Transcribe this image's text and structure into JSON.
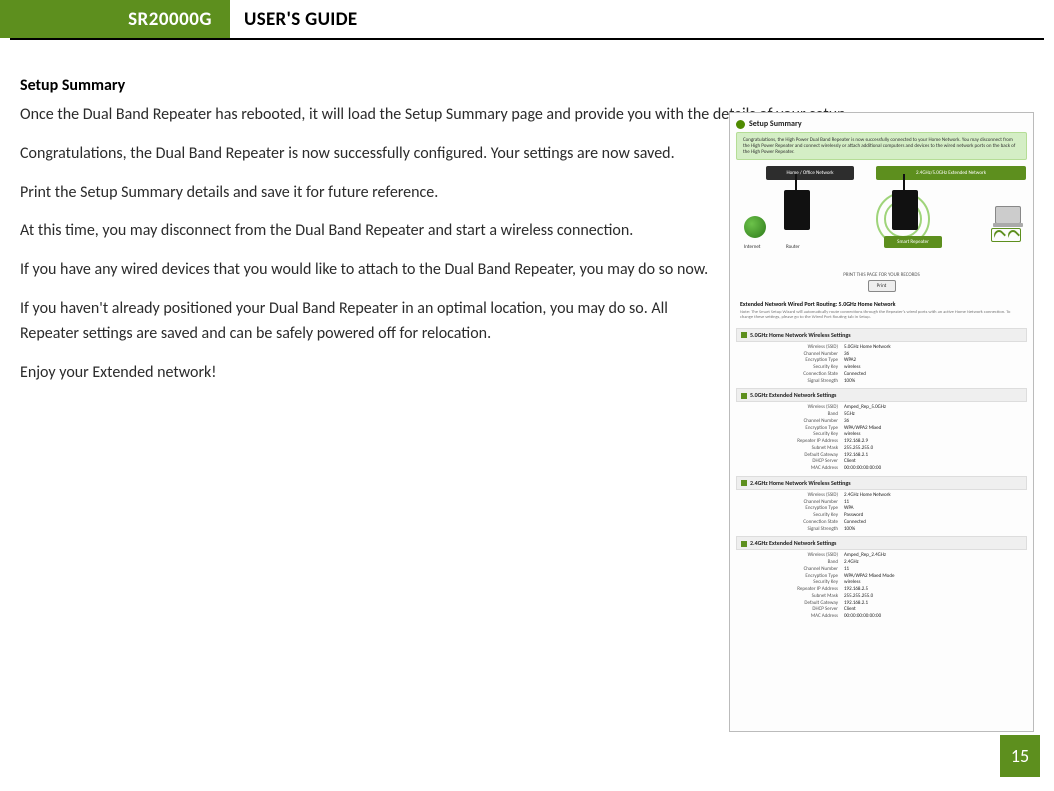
{
  "header": {
    "product": "SR20000G",
    "title": "USER'S GUIDE"
  },
  "page_number": "15",
  "section_title": "Setup Summary",
  "paragraphs": {
    "p1": "Once the Dual Band Repeater has rebooted, it will load the Setup Summary page and provide you with the details of your setup.",
    "p2": "Congratulations, the Dual Band Repeater is now successfully configured. Your settings are now saved.",
    "p3": "Print the Setup Summary details and save it for future reference.",
    "p4": "At this time, you may disconnect from the Dual Band Repeater and start a wireless connection.",
    "p5": "If you have any wired devices that you would like to attach to the Dual Band Repeater, you may do so now.",
    "p6": "If you haven't already positioned your Dual Band Repeater in an optimal location, you may do so. All Repeater settings are saved and can be safely powered off for relocation.",
    "p7": "Enjoy your Extended network!"
  },
  "screenshot": {
    "title": "Setup Summary",
    "congrats": "Congratulations, the High Power Dual Band Repeater is now successfully connected to your Home Network. You may disconnect from the High Power Repeater and connect wirelessly or attach additional computers and devices to the wired network ports on the back of the High Power Repeater.",
    "pill_left": "Home / Office Network",
    "pill_right": "2.4GHz/5.0GHz Extended Network",
    "label_internet": "Internet",
    "label_router": "Router",
    "tag_repeater": "Smart Repeater",
    "print_note": "PRINT THIS PAGE FOR YOUR RECORDS",
    "print_btn": "Print",
    "extended_routing": "Extended Network Wired Port Routing:   5.0GHz Home Network",
    "extended_note": "Note: The Smart Setup Wizard will automatically route connections through the Repeater's wired ports with an active Home Network connection. To change these settings, please go to the Wired Port Routing tab in Setup.",
    "sections": [
      {
        "heading": "5.0GHz Home Network Wireless Settings",
        "rows": [
          {
            "k": "Wireless (SSID)",
            "v": "5.0GHz Home Network"
          },
          {
            "k": "Channel Number",
            "v": "36"
          },
          {
            "k": "Encryption Type",
            "v": "WPA2"
          },
          {
            "k": "Security Key",
            "v": "wireless"
          },
          {
            "k": "Connection State",
            "v": "Connected"
          },
          {
            "k": "Signal Strength",
            "v": "100%"
          }
        ]
      },
      {
        "heading": "5.0GHz Extended Network Settings",
        "rows": [
          {
            "k": "Wireless (SSID)",
            "v": "Amped_Rep_5.0GHz"
          },
          {
            "k": "Band",
            "v": "5GHz"
          },
          {
            "k": "Channel Number",
            "v": "36"
          },
          {
            "k": "Encryption Type",
            "v": "WPA/WPA2 Mixed"
          },
          {
            "k": "Security Key",
            "v": "wireless"
          },
          {
            "k": "Repeater IP Address",
            "v": "192.168.2.9"
          },
          {
            "k": "Subnet Mask",
            "v": "255.255.255.0"
          },
          {
            "k": "Default Gateway",
            "v": "192.168.2.1"
          },
          {
            "k": "DHCP Server",
            "v": "Client"
          },
          {
            "k": "MAC Address",
            "v": "00:00:00:00:00:00"
          }
        ]
      },
      {
        "heading": "2.4GHz Home Network Wireless Settings",
        "rows": [
          {
            "k": "Wireless (SSID)",
            "v": "2.4GHz Home Network"
          },
          {
            "k": "Channel Number",
            "v": "11"
          },
          {
            "k": "Encryption Type",
            "v": "WPA"
          },
          {
            "k": "Security Key",
            "v": "Password"
          },
          {
            "k": "Connection State",
            "v": "Connected"
          },
          {
            "k": "Signal Strength",
            "v": "100%"
          }
        ]
      },
      {
        "heading": "2.4GHz Extended Network Settings",
        "rows": [
          {
            "k": "Wireless (SSID)",
            "v": "Amped_Rep_2.4GHz"
          },
          {
            "k": "Band",
            "v": "2.4GHz"
          },
          {
            "k": "Channel Number",
            "v": "11"
          },
          {
            "k": "Encryption Type",
            "v": "WPA/WPA2 Mixed Mode"
          },
          {
            "k": "Security Key",
            "v": "wireless"
          },
          {
            "k": "Repeater IP Address",
            "v": "192.168.2.5"
          },
          {
            "k": "Subnet Mask",
            "v": "255.255.255.0"
          },
          {
            "k": "Default Gateway",
            "v": "192.168.2.1"
          },
          {
            "k": "DHCP Server",
            "v": "Client"
          },
          {
            "k": "MAC Address",
            "v": "00:00:00:00:00:00"
          }
        ]
      }
    ]
  }
}
